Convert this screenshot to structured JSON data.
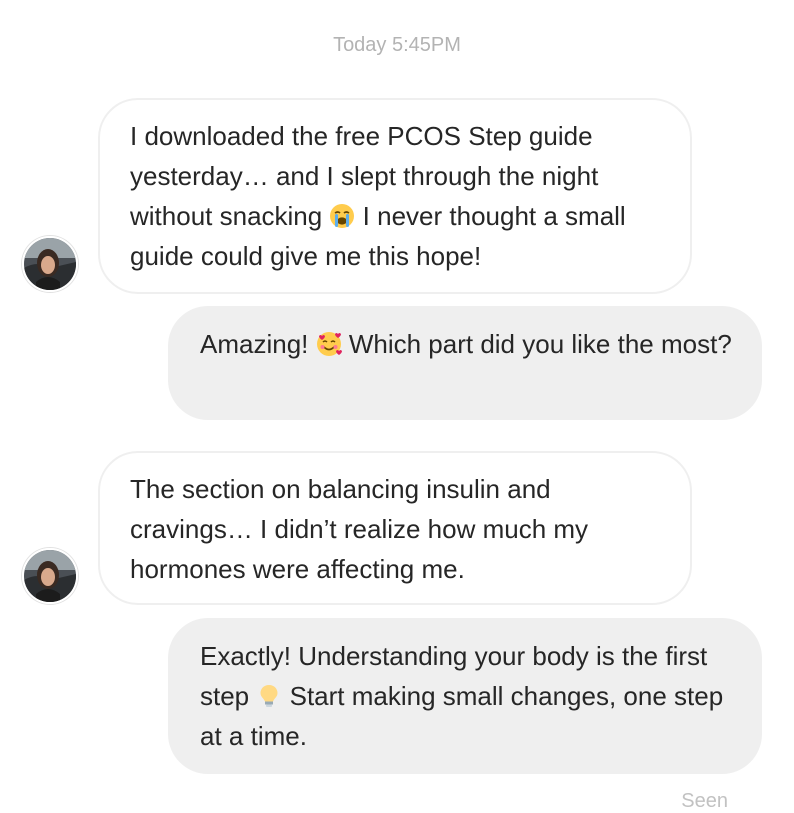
{
  "timestamp": "Today 5:45PM",
  "messages": [
    {
      "sender": "them",
      "parts": [
        " I downloaded the free PCOS Step guide yesterday… and I slept through the night without snacking ",
        " I never thought a small guide could give me this hope!"
      ],
      "emoji": "loudly-crying-face"
    },
    {
      "sender": "me",
      "parts": [
        " Amazing! ",
        " Which part did you like the most?"
      ],
      "emoji": "smiling-face-with-hearts"
    },
    {
      "sender": "them",
      "parts": [
        "The section on balancing insulin and cravings… I didn’t realize how much my hormones were affecting me."
      ]
    },
    {
      "sender": "me",
      "parts": [
        "Exactly! Understanding your body is the first step ",
        " Start making small changes, one step at a time."
      ],
      "emoji": "light-bulb"
    }
  ],
  "status": "Seen",
  "colors": {
    "incoming_border": "#efefef",
    "outgoing_bg": "#efefef",
    "text": "#262626",
    "muted": "#b3b3b3"
  }
}
